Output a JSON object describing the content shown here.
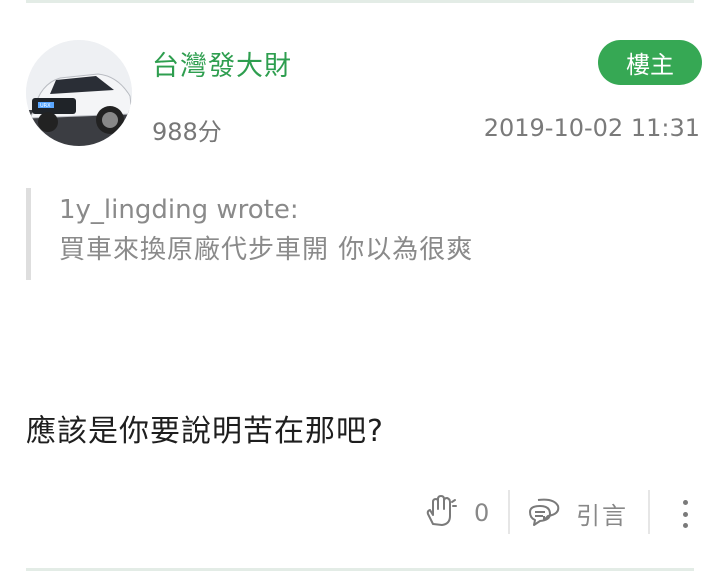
{
  "post": {
    "author": {
      "name": "台灣發大財",
      "score": "988分",
      "avatar": "car-avatar-image"
    },
    "badge": "樓主",
    "timestamp": "2019-10-02 11:31",
    "quote": {
      "author_line": "1y_lingding wrote:",
      "text": "買車來換原廠代步車開 你以為很爽"
    },
    "body": "應該是你要說明苦在那吧?",
    "actions": {
      "like_icon": "clap-hands-icon",
      "like_count": "0",
      "quote_icon": "chat-bubbles-icon",
      "quote_label": "引言",
      "more_icon": "more-vertical-icon"
    }
  },
  "colors": {
    "accent": "#36a854",
    "username": "#2e9e4f",
    "muted": "#888888"
  }
}
